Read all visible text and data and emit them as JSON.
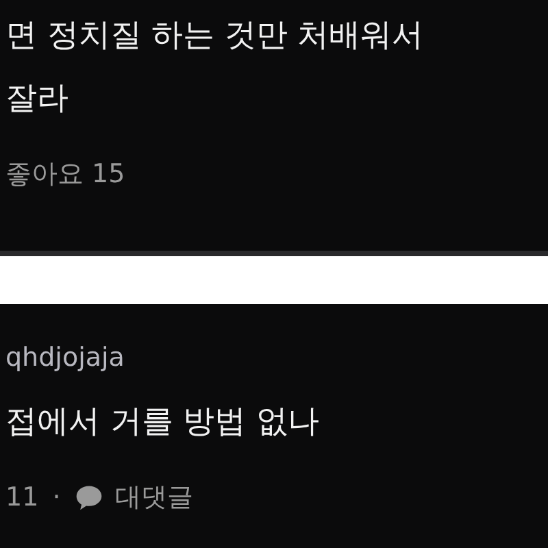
{
  "comments": [
    {
      "lines": [
        "면 정치질 하는 것만 처배워서",
        "잘라"
      ],
      "meta": [
        {
          "kind": "likes",
          "text": "좋아요 15"
        }
      ]
    },
    {
      "author": "qhdjojaja",
      "lines": [
        "접에서 거를 방법 없나"
      ],
      "meta": [
        {
          "kind": "likes",
          "text": "11"
        },
        {
          "kind": "separator",
          "text": "·"
        },
        {
          "kind": "reply",
          "text": "대댓글"
        }
      ]
    }
  ]
}
